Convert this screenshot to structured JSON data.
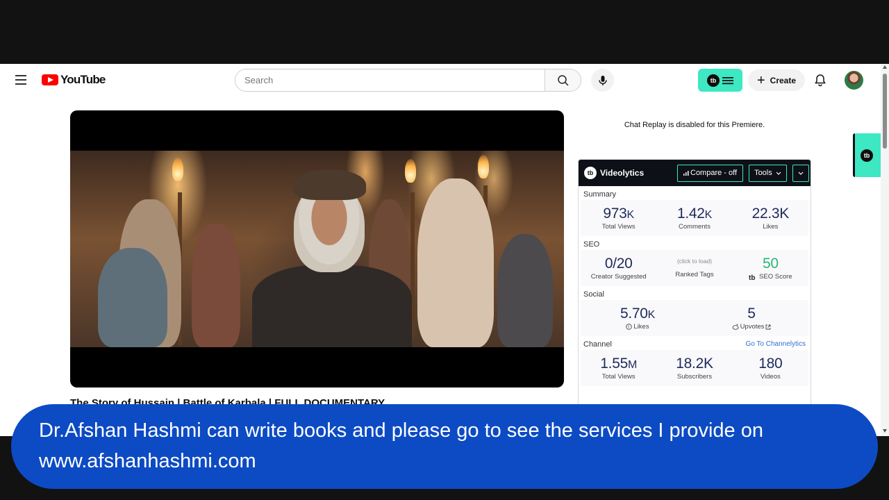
{
  "header": {
    "logo_text": "YouTube",
    "search_placeholder": "Search",
    "create_label": "Create"
  },
  "video": {
    "title": "The Story of Hussain | Battle of Karbala | FULL DOCUMENTARY"
  },
  "chat": {
    "note": "Chat Replay is disabled for this Premiere."
  },
  "videolytics": {
    "brand": "Videolytics",
    "compare_label": "Compare - off",
    "tools_label": "Tools",
    "summary": {
      "title": "Summary",
      "stats": [
        {
          "value": "973",
          "unit": "K",
          "label": "Total Views"
        },
        {
          "value": "1.42",
          "unit": "K",
          "label": "Comments"
        },
        {
          "value": "22.3K",
          "unit": "",
          "label": "Likes"
        }
      ]
    },
    "seo": {
      "title": "SEO",
      "creator_value": "0/20",
      "creator_label": "Creator Suggested",
      "ranked_hint": "(click to load)",
      "ranked_label": "Ranked Tags",
      "score_value": "50",
      "score_label": "SEO Score"
    },
    "social": {
      "title": "Social",
      "likes_value": "5.70",
      "likes_unit": "K",
      "likes_label": "Likes",
      "upvotes_value": "5",
      "upvotes_label": "Upvotes"
    },
    "channel": {
      "title": "Channel",
      "link": "Go To Channelytics",
      "stats": [
        {
          "value": "1.55",
          "unit": "M",
          "label": "Total Views"
        },
        {
          "value": "18.2K",
          "unit": "",
          "label": "Subscribers"
        },
        {
          "value": "180",
          "unit": "",
          "label": "Videos"
        }
      ]
    }
  },
  "banner": {
    "text": "Dr.Afshan Hashmi can write books and please go to see the services I provide on www.afshanhashmi.com"
  },
  "colors": {
    "accent": "#3de8c2",
    "banner": "#0d4bc4",
    "youtube_red": "#ff0000",
    "seo_green": "#2bb673"
  }
}
